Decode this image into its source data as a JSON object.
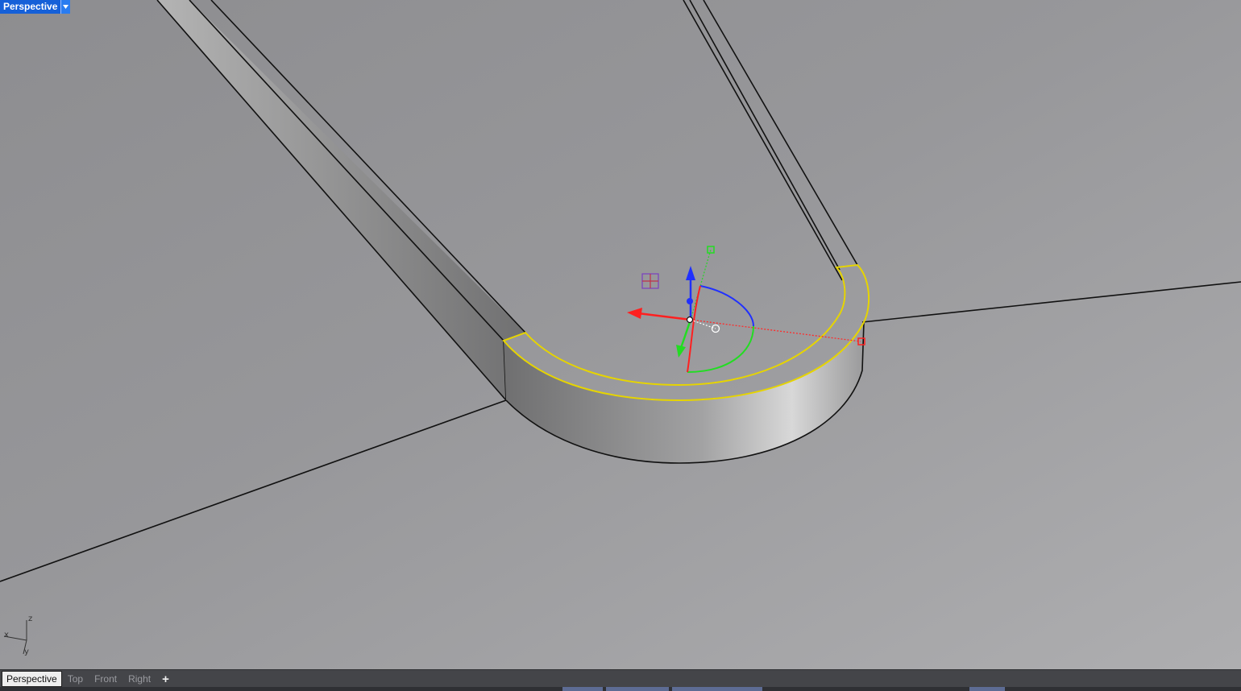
{
  "viewport": {
    "name": "Perspective",
    "axis": {
      "x": "x",
      "y": "y",
      "z": "z"
    }
  },
  "tabs": [
    {
      "label": "Perspective",
      "active": true
    },
    {
      "label": "Top",
      "active": false
    },
    {
      "label": "Front",
      "active": false
    },
    {
      "label": "Right",
      "active": false
    }
  ],
  "add_tab_label": "+",
  "colors": {
    "viewport_bg": "#8a8a8d",
    "selection": "#e6d400",
    "gizmo_x": "#ff1e1e",
    "gizmo_y": "#18c818",
    "gizmo_z": "#1e3cff",
    "label_bg": "#1560d8"
  },
  "icons": [
    "dropdown-arrow-icon",
    "plus-icon",
    "gumball-widget",
    "axis-triad"
  ]
}
